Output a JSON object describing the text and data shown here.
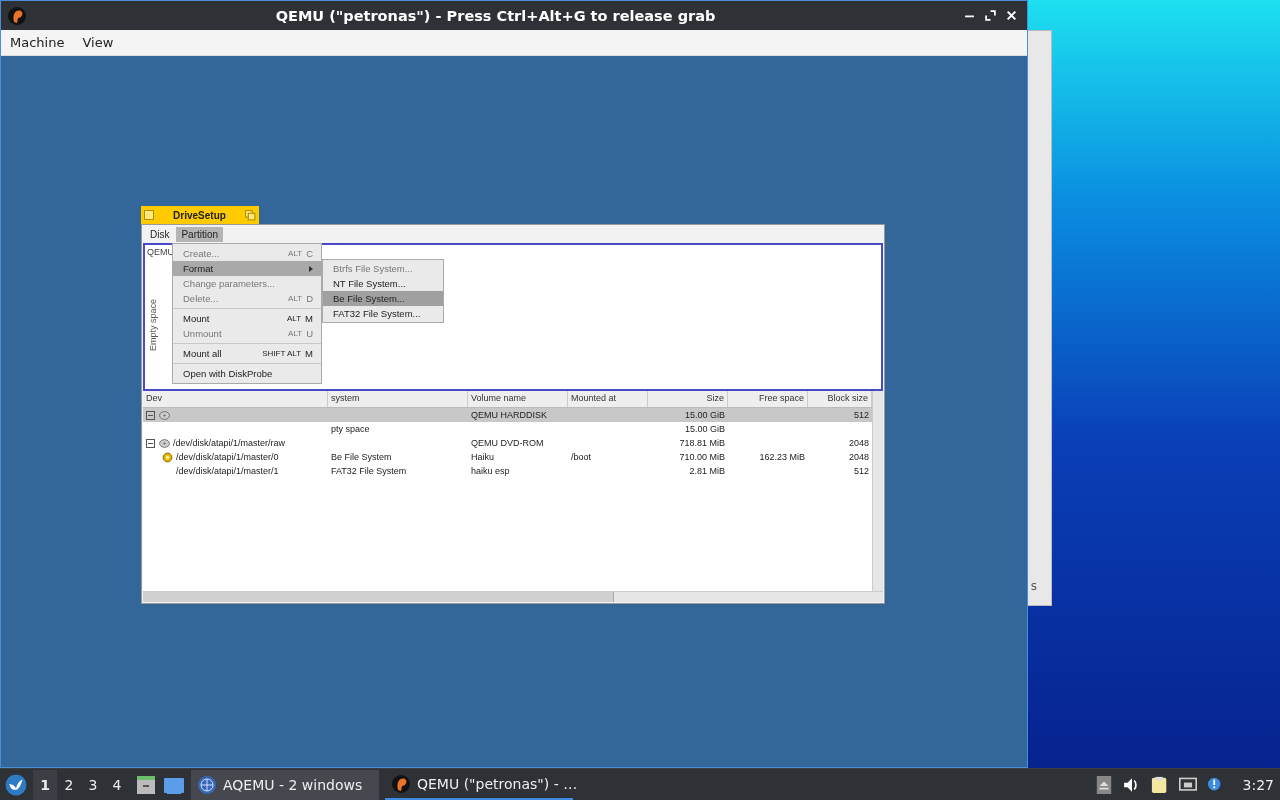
{
  "window": {
    "title": "QEMU (\"petronas\") - Press Ctrl+Alt+G to release grab",
    "menu": [
      "Machine",
      "View"
    ]
  },
  "drivesetup": {
    "title": "DriveSetup",
    "menu": [
      {
        "label": "Disk",
        "selected": false
      },
      {
        "label": "Partition",
        "selected": true
      }
    ],
    "disk_map": {
      "disk_label": "QEMU",
      "partition_label": "Empty space"
    },
    "columns": [
      "Dev",
      "system",
      "Volume name",
      "Mounted at",
      "Size",
      "Free space",
      "Block size"
    ],
    "rows": [
      {
        "kind": "disk",
        "selected": true,
        "expanded": true,
        "volume": "QEMU HARDDISK",
        "size": "15.00 GiB",
        "block": "512",
        "children": [
          {
            "kind": "partition",
            "selected": false,
            "fs": "pty space",
            "size": "15.00 GiB"
          }
        ]
      },
      {
        "kind": "disk",
        "selected": false,
        "expanded": true,
        "device": "/dev/disk/atapi/1/master/raw",
        "volume": "QEMU DVD-ROM",
        "size": "718.81 MiB",
        "block": "2048",
        "children": [
          {
            "kind": "partition",
            "selected": false,
            "mounted_icon": true,
            "device": "/dev/disk/atapi/1/master/0",
            "fs": "Be File System",
            "volume": "Haiku",
            "mounted": "/boot",
            "size": "710.00 MiB",
            "free": "162.23 MiB",
            "block": "2048"
          },
          {
            "kind": "partition",
            "selected": false,
            "mounted_icon": false,
            "device": "/dev/disk/atapi/1/master/1",
            "fs": "FAT32 File System",
            "volume": "haiku esp",
            "size": "2.81 MiB",
            "block": "512"
          }
        ]
      }
    ],
    "context_menu": [
      {
        "kind": "item",
        "label": "Create...",
        "modifier": "ALT",
        "key": "C",
        "disabled": true,
        "selected": false
      },
      {
        "kind": "submenu",
        "label": "Format",
        "disabled": false,
        "selected": true
      },
      {
        "kind": "item",
        "label": "Change parameters...",
        "disabled": true,
        "selected": false
      },
      {
        "kind": "item",
        "label": "Delete...",
        "modifier": "ALT",
        "key": "D",
        "disabled": true,
        "selected": false
      },
      {
        "kind": "separator"
      },
      {
        "kind": "item",
        "label": "Mount",
        "modifier": "ALT",
        "key": "M",
        "disabled": false,
        "selected": false
      },
      {
        "kind": "item",
        "label": "Unmount",
        "modifier": "ALT",
        "key": "U",
        "disabled": true,
        "selected": false
      },
      {
        "kind": "separator"
      },
      {
        "kind": "item",
        "label": "Mount all",
        "modifier": "SHIFT ALT",
        "key": "M",
        "disabled": false,
        "selected": false
      },
      {
        "kind": "separator"
      },
      {
        "kind": "item",
        "label": "Open with DiskProbe",
        "disabled": false,
        "selected": false
      }
    ],
    "submenu": [
      {
        "label": "Btrfs File System...",
        "disabled": true,
        "selected": false
      },
      {
        "label": "NT File System...",
        "disabled": false,
        "selected": false
      },
      {
        "label": "Be File System...",
        "disabled": false,
        "selected": true
      },
      {
        "label": "FAT32 File System...",
        "disabled": false,
        "selected": false
      }
    ]
  },
  "background_window": {
    "partial_text": "s"
  },
  "taskbar": {
    "workspaces": [
      {
        "label": "1",
        "selected": true
      },
      {
        "label": "2",
        "selected": false
      },
      {
        "label": "3",
        "selected": false
      },
      {
        "label": "4",
        "selected": false
      }
    ],
    "tasks": [
      {
        "label": "AQEMU - 2 windows",
        "selected": false
      },
      {
        "label": "QEMU (\"petronas\") - …",
        "selected": true
      }
    ],
    "clock": "3:27"
  }
}
